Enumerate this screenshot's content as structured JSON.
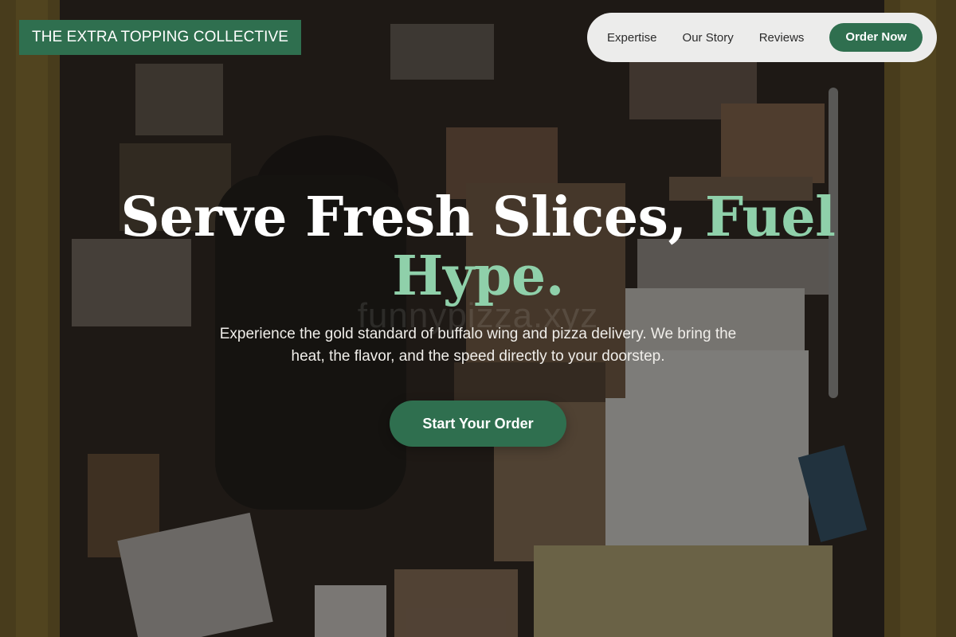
{
  "brand": {
    "name": "THE EXTRA TOPPING COLLECTIVE"
  },
  "nav": {
    "links": [
      "Expertise",
      "Our Story",
      "Reviews"
    ],
    "order_label": "Order Now"
  },
  "hero": {
    "title_main": "Serve Fresh Slices, ",
    "title_accent": "Fuel Hype.",
    "watermark": "funnypizza.xyz",
    "subtitle": "Experience the gold standard of buffalo wing and pizza delivery. We bring the heat, the flavor, and the speed directly to your doorstep.",
    "cta_label": "Start Your Order",
    "background_description_icon": "delivery-van-boxes-photo"
  },
  "colors": {
    "brand_green": "#2f6f4f",
    "accent_mint": "#8fd0aa",
    "nav_bg": "#ececeb"
  }
}
